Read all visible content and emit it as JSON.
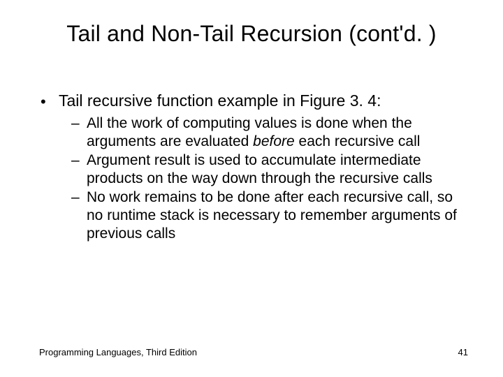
{
  "title": "Tail and Non-Tail Recursion (cont'd. )",
  "bullets": {
    "main": "Tail recursive function example in Figure 3. 4:",
    "sub1_a": "All the work of computing values is done when the arguments are evaluated ",
    "sub1_b_italic": "before",
    "sub1_c": " each recursive call",
    "sub2": "Argument result is used to accumulate intermediate products on the way down through the recursive calls",
    "sub3": "No work remains to be done after each recursive call, so no runtime stack is necessary to remember arguments of previous calls"
  },
  "footer": {
    "left": "Programming Languages, Third Edition",
    "page": "41"
  }
}
